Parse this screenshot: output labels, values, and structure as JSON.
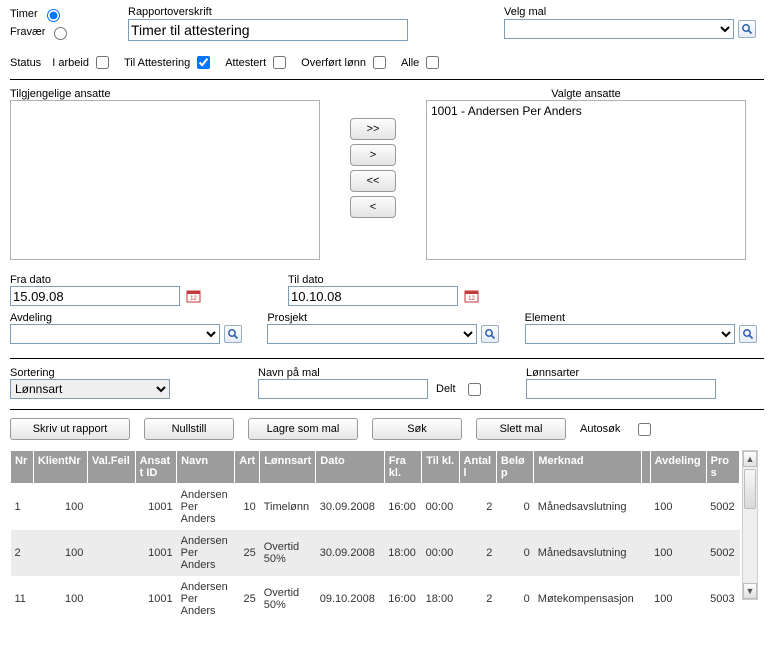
{
  "top": {
    "timer_label": "Timer",
    "fravaer_label": "Fravær",
    "mode": "timer",
    "rapport_label": "Rapportoverskrift",
    "rapport_value": "Timer til attestering",
    "velgmal_label": "Velg mal"
  },
  "status": {
    "label": "Status",
    "iarbeid": "I arbeid",
    "tilatt": "Til Attestering",
    "attestert": "Attestert",
    "overfort": "Overført lønn",
    "alle": "Alle",
    "checked": "tilatt"
  },
  "dual": {
    "available_label": "Tilgjengelige ansatte",
    "selected_label": "Valgte ansatte",
    "selected_items": [
      "1001 - Andersen Per Anders"
    ],
    "btn_all_r": ">>",
    "btn_one_r": ">",
    "btn_all_l": "<<",
    "btn_one_l": "<"
  },
  "dates": {
    "from_label": "Fra dato",
    "from_value": "15.09.08",
    "to_label": "Til dato",
    "to_value": "10.10.08"
  },
  "filters": {
    "avdeling_label": "Avdeling",
    "prosjekt_label": "Prosjekt",
    "element_label": "Element"
  },
  "mid": {
    "sort_label": "Sortering",
    "sort_value": "Lønnsart",
    "malnavn_label": "Navn på mal",
    "delt_label": "Delt",
    "lonnsarter_label": "Lønnsarter"
  },
  "buttons": {
    "skriv": "Skriv ut rapport",
    "nullstill": "Nullstill",
    "lagre": "Lagre som mal",
    "sok": "Søk",
    "slett": "Slett mal",
    "autosok": "Autosøk"
  },
  "grid": {
    "headers": [
      "Nr",
      "KlientNr",
      "Val.Feil",
      "Ansatt ID",
      "Navn",
      "Art",
      "Lønnsart",
      "Dato",
      "Fra kl.",
      "Til kl.",
      "Antall",
      "Beløp",
      "Merknad",
      "",
      "Avdeling",
      "Pros"
    ],
    "rows": [
      {
        "nr": "1",
        "klient": "100",
        "valfeil": "",
        "ansatt": "1001",
        "navn": "Andersen Per Anders",
        "art": "10",
        "lonnsart": "Timelønn",
        "dato": "30.09.2008",
        "fra": "16:00",
        "til": "00:00",
        "antall": "2",
        "belop": "0",
        "merknad": "Månedsavslutning",
        "blank": "",
        "avd": "100",
        "pros": "5002"
      },
      {
        "nr": "2",
        "klient": "100",
        "valfeil": "",
        "ansatt": "1001",
        "navn": "Andersen Per Anders",
        "art": "25",
        "lonnsart": "Overtid 50%",
        "dato": "30.09.2008",
        "fra": "18:00",
        "til": "00:00",
        "antall": "2",
        "belop": "0",
        "merknad": "Månedsavslutning",
        "blank": "",
        "avd": "100",
        "pros": "5002"
      },
      {
        "nr": "11",
        "klient": "100",
        "valfeil": "",
        "ansatt": "1001",
        "navn": "Andersen Per Anders",
        "art": "25",
        "lonnsart": "Overtid 50%",
        "dato": "09.10.2008",
        "fra": "16:00",
        "til": "18:00",
        "antall": "2",
        "belop": "0",
        "merknad": "Møtekompensasjon",
        "blank": "",
        "avd": "100",
        "pros": "5003"
      }
    ]
  }
}
